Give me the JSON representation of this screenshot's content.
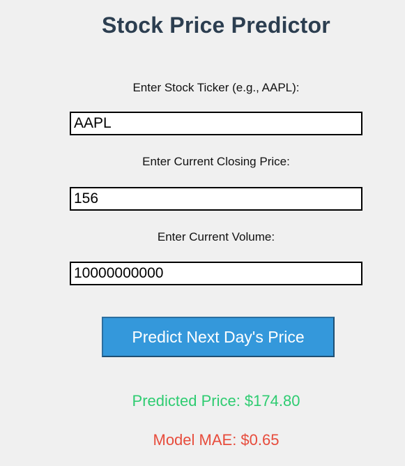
{
  "app": {
    "title": "Stock Price Predictor"
  },
  "form": {
    "ticker": {
      "label": "Enter Stock Ticker (e.g., AAPL):",
      "value": "AAPL"
    },
    "closing_price": {
      "label": "Enter Current Closing Price:",
      "value": "156"
    },
    "volume": {
      "label": "Enter Current Volume:",
      "value": "10000000000"
    },
    "predict_button_label": "Predict Next Day's Price"
  },
  "results": {
    "predicted_price": "Predicted Price: $174.80",
    "model_mae": "Model MAE: $0.65"
  },
  "colors": {
    "title": "#2c3e50",
    "button_bg": "#3498db",
    "predicted_text": "#2ecc71",
    "mae_text": "#e74c3c",
    "background": "#f0f0f0"
  }
}
